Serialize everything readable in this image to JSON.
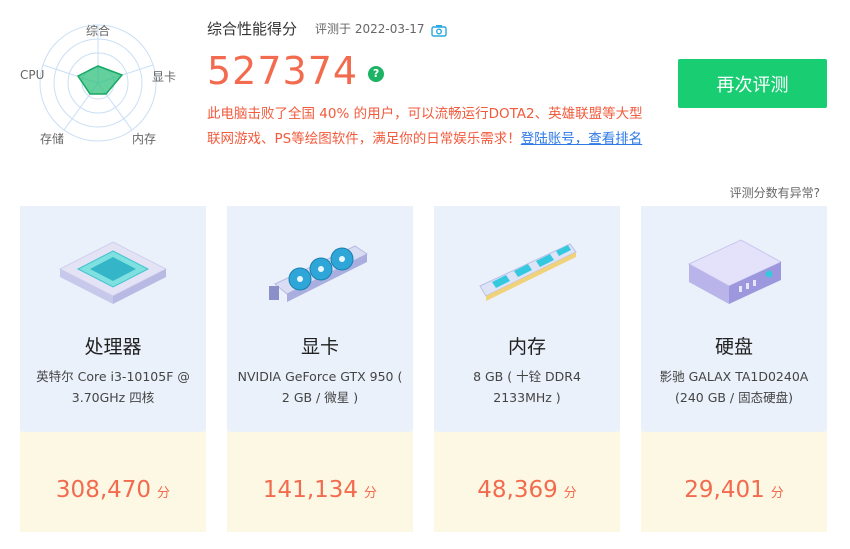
{
  "radar": {
    "labels": {
      "overall": "综合",
      "gpu": "显卡",
      "memory": "内存",
      "storage": "存储",
      "cpu": "CPU"
    }
  },
  "summary": {
    "title": "综合性能得分",
    "eval_date": "评测于 2022-03-17",
    "score": "527374",
    "help_symbol": "?",
    "description": "此电脑击败了全国 40% 的用户，可以流畅运行DOTA2、英雄联盟等大型联网游戏、PS等绘图软件，满足你的日常娱乐需求！",
    "login_link": "登陆账号，查看排名"
  },
  "actions": {
    "retest_label": "再次评测",
    "anomaly_link": "评测分数有异常?"
  },
  "colors": {
    "accent": "#19cd73",
    "score": "#f26b4f",
    "link": "#2f7ae5"
  },
  "cards": [
    {
      "title": "处理器",
      "spec": "英特尔 Core i3-10105F @ 3.70GHz 四核",
      "score": "308,470",
      "unit": "分",
      "icon": "cpu-chip-icon"
    },
    {
      "title": "显卡",
      "spec": "NVIDIA GeForce GTX 950 ( 2 GB / 微星 )",
      "score": "141,134",
      "unit": "分",
      "icon": "graphics-card-icon"
    },
    {
      "title": "内存",
      "spec": "8 GB ( 十铨 DDR4 2133MHz )",
      "score": "48,369",
      "unit": "分",
      "icon": "memory-stick-icon"
    },
    {
      "title": "硬盘",
      "spec": "影驰 GALAX TA1D0240A (240 GB / 固态硬盘)",
      "score": "29,401",
      "unit": "分",
      "icon": "hard-drive-icon"
    }
  ]
}
